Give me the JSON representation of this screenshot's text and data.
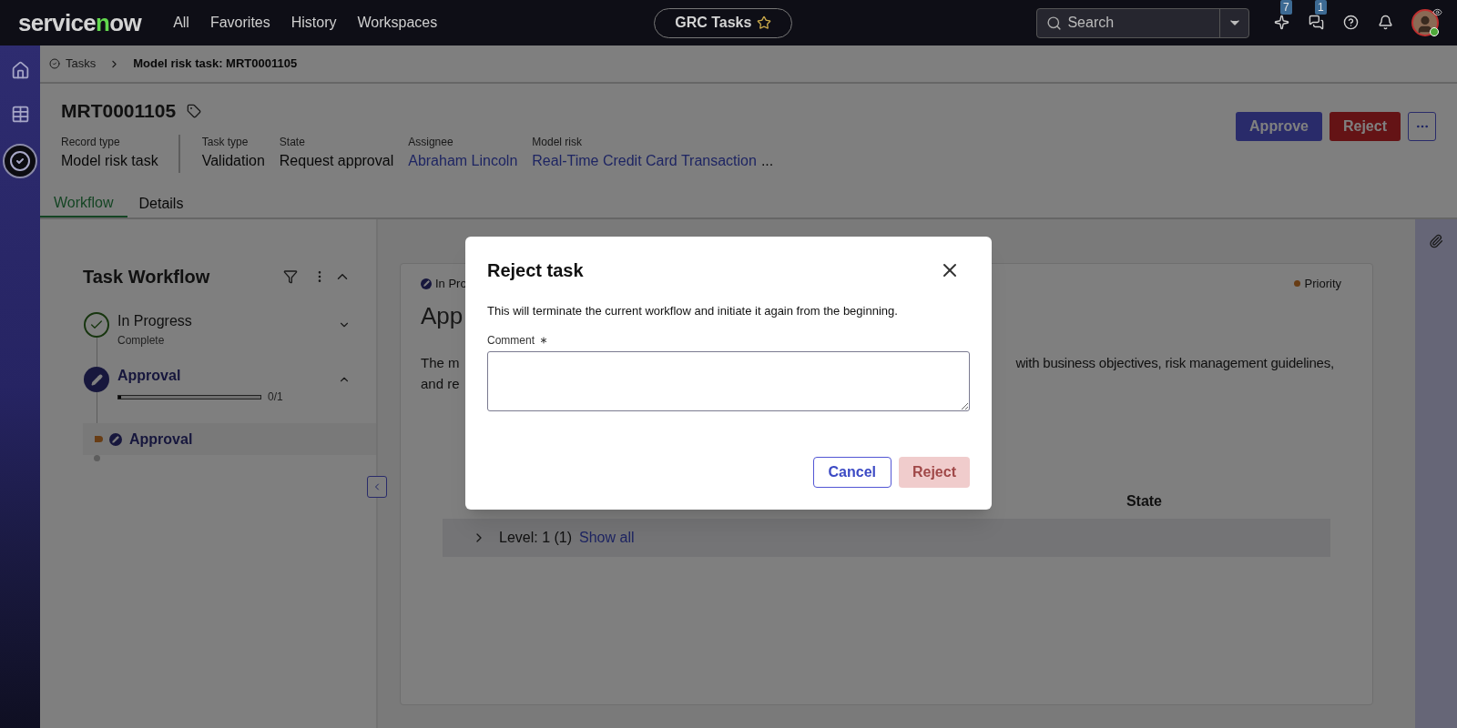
{
  "nav": {
    "logo": "servicenow",
    "menu": [
      "All",
      "Favorites",
      "History",
      "Workspaces"
    ],
    "workspace": "GRC Tasks",
    "search": {
      "placeholder": "Search"
    },
    "icons": [
      {
        "kind": "sparkle",
        "count": "7"
      },
      {
        "kind": "chat",
        "count": "1"
      },
      {
        "kind": "help"
      },
      {
        "kind": "bell"
      }
    ]
  },
  "rail": [
    {
      "kind": "home",
      "selected": false
    },
    {
      "kind": "grid",
      "selected": false
    },
    {
      "kind": "check",
      "selected": true
    }
  ],
  "breadcrumb": [
    "Tasks",
    "Model risk task: MRT0001105"
  ],
  "record": {
    "number": "MRT0001105",
    "fields": [
      {
        "label": "Record type",
        "value": "Model risk task",
        "link": false
      },
      {
        "label": "Task type",
        "value": "Validation",
        "link": false
      },
      {
        "label": "State",
        "value": "Request approval",
        "link": false
      },
      {
        "label": "Assignee",
        "value": "Abraham Lincoln",
        "link": true
      },
      {
        "label": "Model risk",
        "value": "Real-Time Credit Card Transaction",
        "link": true,
        "more": "..."
      }
    ],
    "actions": [
      {
        "label": "Approve",
        "kind": "primary"
      },
      {
        "label": "Reject",
        "kind": "danger"
      }
    ]
  },
  "tabs": [
    {
      "label": "Workflow",
      "selected": true
    },
    {
      "label": "Details",
      "selected": false
    }
  ],
  "workflow": {
    "title": "Task Workflow",
    "stages": [
      {
        "name": "In Progress",
        "status": "Complete",
        "kind": "complete",
        "expanded": false
      },
      {
        "name": "Approval",
        "kind": "active",
        "expanded": true,
        "level": 0.02,
        "progress": "0/1",
        "children": [
          {
            "name": "Approval",
            "selected": true
          }
        ]
      }
    ]
  },
  "card": {
    "status": "In Pro",
    "title": "App",
    "priority": "Priority",
    "description_left": [
      "The m",
      "and re"
    ],
    "description_right": "with business objectives, risk management guidelines,",
    "columns": [
      "State"
    ],
    "level_row": {
      "label": "Level: 1 (1)",
      "link": "Show all",
      "expanded": false
    }
  },
  "dialog": {
    "title": "Reject task",
    "message": "This will terminate the current workflow and initiate it again from the beginning.",
    "field": {
      "label": "Comment",
      "required": true
    },
    "buttons": [
      {
        "label": "Cancel",
        "kind": "secondary",
        "disabled": false
      },
      {
        "label": "Reject",
        "kind": "danger",
        "disabled": true
      }
    ]
  }
}
